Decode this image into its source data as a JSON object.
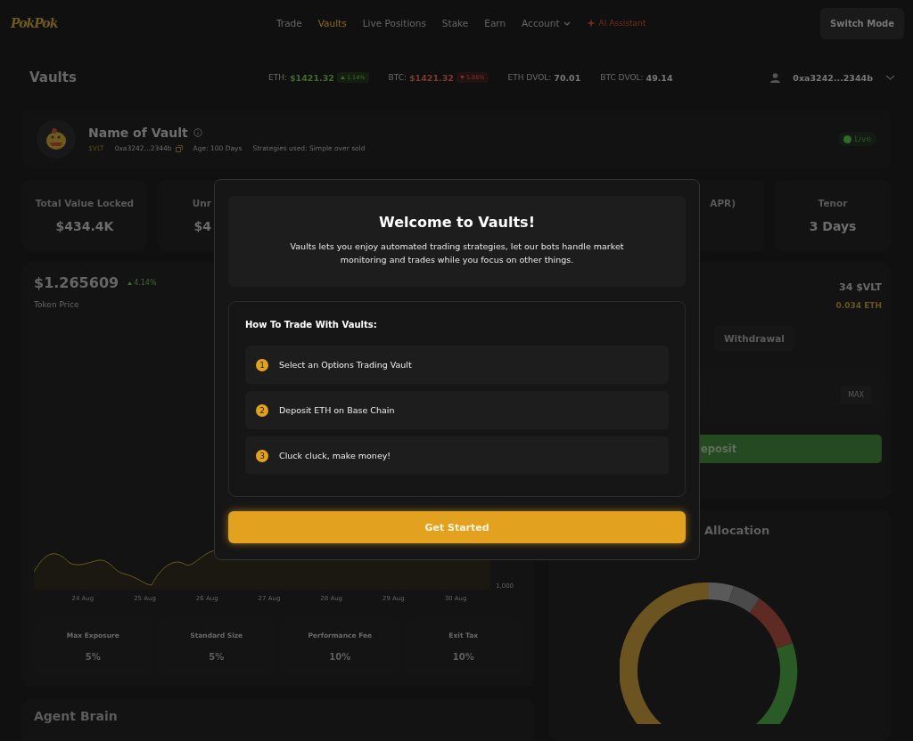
{
  "nav": {
    "logo": "PokPok",
    "items": [
      {
        "label": "Trade",
        "selected": false,
        "kind": "link"
      },
      {
        "label": "Vaults",
        "selected": true,
        "kind": "link"
      },
      {
        "label": "Live Positions",
        "selected": false,
        "kind": "link"
      },
      {
        "label": "Stake",
        "selected": false,
        "kind": "link"
      },
      {
        "label": "Earn",
        "selected": false,
        "kind": "link"
      },
      {
        "label": "Account",
        "selected": false,
        "kind": "dropdown"
      },
      {
        "label": "AI Assistant",
        "selected": false,
        "kind": "ai"
      }
    ],
    "switch_mode": "Switch Mode"
  },
  "page_title": "Vaults",
  "tickers": [
    {
      "label": "ETH:",
      "value": "$1421.32",
      "change": "1.14%",
      "rising": true
    },
    {
      "label": "BTC:",
      "value": "$1421.32",
      "change": "5.86%",
      "rising": false
    }
  ],
  "dvol": [
    {
      "label": "ETH DVOL:",
      "value": "70.01"
    },
    {
      "label": "BTC DVOL:",
      "value": "49.14"
    }
  ],
  "account": "0xa3242...2344b",
  "vault": {
    "name": "Name of Vault",
    "symbol": "$VLT",
    "address": "0xa3242...2344b",
    "age": "Age: 100 Days",
    "strategies": "Strategies used: Simple over sold",
    "status": "Live"
  },
  "stats": [
    {
      "label": "Total Value Locked",
      "value": "$434.4K"
    },
    {
      "label": "Unr",
      "value": "$4"
    },
    {
      "label": "APR)"
    },
    {
      "label": "Tenor",
      "value": "3 Days"
    }
  ],
  "token": {
    "price": "$1.265609",
    "change": "4.14%",
    "rising": true,
    "label": "Token Price"
  },
  "price_chart": {
    "x_labels": [
      "24 Aug",
      "25 Aug",
      "26 Aug",
      "27 Aug",
      "28 Aug",
      "29 Aug",
      "30 Aug"
    ],
    "y_label": "1,000"
  },
  "params": [
    {
      "label": "Max Exposure",
      "value": "5%"
    },
    {
      "label": "Standard Size",
      "value": "5%"
    },
    {
      "label": "Performance Fee",
      "value": "10%"
    },
    {
      "label": "Exit Tax",
      "value": "10%"
    }
  ],
  "balance": {
    "amount": "34 $VLT",
    "eth": "0.034 ETH"
  },
  "tabs": [
    {
      "label": "Withdrawal",
      "selected": false
    }
  ],
  "max_button": "MAX",
  "deposit_button": "eposit",
  "allocation_title": "Allocation",
  "agent_brain_title": "Agent Brain",
  "modal": {
    "title": "Welcome to Vaults!",
    "description": "Vaults lets you enjoy automated trading strategies, let our bots handle market monitoring and trades while you focus on other things.",
    "steps_title": "How To Trade With Vaults:",
    "steps": [
      {
        "number": "1",
        "text": "Select an Options Trading Vault"
      },
      {
        "number": "2",
        "text": "Deposit ETH on Base Chain"
      },
      {
        "number": "3",
        "text": "Cluck cluck, make money!"
      }
    ],
    "button": "Get Started"
  }
}
